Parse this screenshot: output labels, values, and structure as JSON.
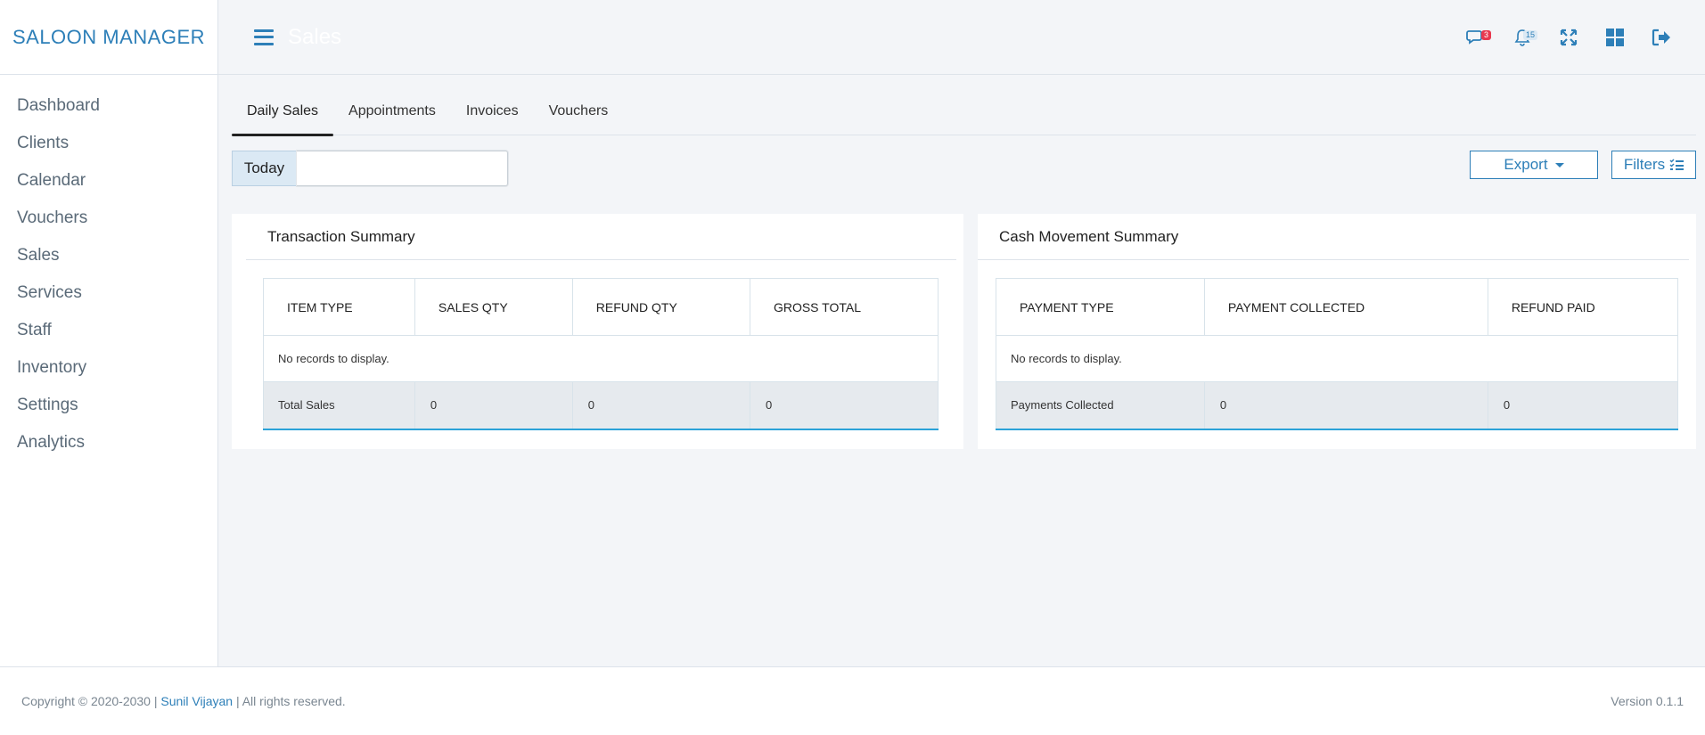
{
  "brand": "SALOON MANAGER",
  "sidebar": {
    "items": [
      {
        "label": "Dashboard"
      },
      {
        "label": "Clients"
      },
      {
        "label": "Calendar"
      },
      {
        "label": "Vouchers"
      },
      {
        "label": "Sales"
      },
      {
        "label": "Services"
      },
      {
        "label": "Staff"
      },
      {
        "label": "Inventory"
      },
      {
        "label": "Settings"
      },
      {
        "label": "Analytics"
      }
    ]
  },
  "header": {
    "title": "Sales",
    "messages_count": "3",
    "notifications_count": "15",
    "icons": [
      "menu-icon",
      "chat-icon",
      "bell-icon",
      "fullscreen-icon",
      "grid-icon",
      "logout-icon"
    ],
    "accent_color": "#2d7fb8"
  },
  "tabs": [
    {
      "label": "Daily Sales",
      "active": true
    },
    {
      "label": "Appointments"
    },
    {
      "label": "Invoices"
    },
    {
      "label": "Vouchers"
    }
  ],
  "toolbar": {
    "date_label": "Today",
    "date_value": "",
    "export_label": "Export",
    "filters_label": "Filters"
  },
  "transaction_summary": {
    "title": "Transaction Summary",
    "columns": [
      "ITEM TYPE",
      "SALES QTY",
      "REFUND QTY",
      "GROSS TOTAL"
    ],
    "empty_text": "No records to display.",
    "totals": [
      "Total Sales",
      "0",
      "0",
      "0"
    ]
  },
  "cash_movement_summary": {
    "title": "Cash Movement Summary",
    "columns": [
      "PAYMENT TYPE",
      "PAYMENT COLLECTED",
      "REFUND PAID"
    ],
    "empty_text": "No records to display.",
    "totals": [
      "Payments Collected",
      "0",
      "0"
    ]
  },
  "footer": {
    "copyright": "Copyright © 2020-2030 |",
    "author": "Sunil Vijayan",
    "rights": "| All rights reserved.",
    "version": "Version 0.1.1"
  }
}
